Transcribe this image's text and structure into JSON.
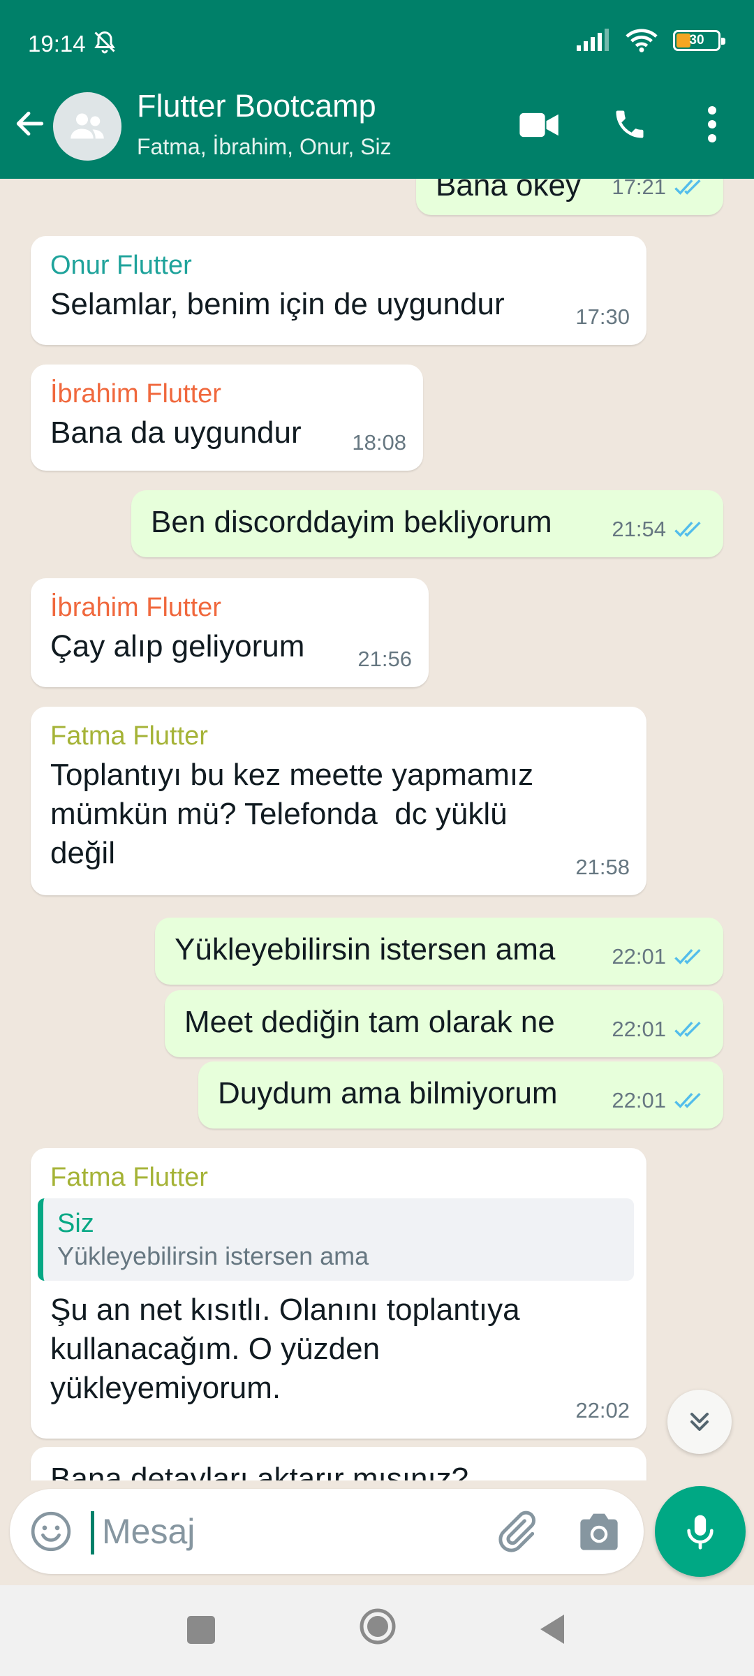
{
  "status_bar": {
    "time": "19:14",
    "battery": "30"
  },
  "header": {
    "title": "Flutter Bootcamp",
    "subtitle": "Fatma, İbrahim, Onur, Siz"
  },
  "colors": {
    "header": "#008069",
    "accent": "#00a884",
    "outgoing_bubble": "#e7ffdb",
    "incoming_bubble": "#ffffff",
    "sender_onur": "#1fa39b",
    "sender_ibrahim": "#f0683d",
    "sender_fatma": "#a5b337",
    "read_ticks": "#53bdeb"
  },
  "messages": [
    {
      "dir": "out",
      "text": "Bana okey",
      "time": "17:21",
      "read": true
    },
    {
      "dir": "in",
      "sender": "Onur Flutter",
      "text": "Selamlar, benim için de uygundur",
      "time": "17:30"
    },
    {
      "dir": "in",
      "sender": "İbrahim Flutter",
      "text": "Bana da uygundur",
      "time": "18:08"
    },
    {
      "dir": "out",
      "text": "Ben discorddayim bekliyorum",
      "time": "21:54",
      "read": true
    },
    {
      "dir": "in",
      "sender": "İbrahim Flutter",
      "text": "Çay alıp geliyorum",
      "time": "21:56"
    },
    {
      "dir": "in",
      "sender": "Fatma Flutter",
      "text": "Toplantıyı bu kez meette yapmamız\nmümkün mü? Telefonda  dc yüklü\ndeğil",
      "time": "21:58"
    },
    {
      "dir": "out",
      "text": "Yükleyebilirsin istersen ama",
      "time": "22:01",
      "read": true
    },
    {
      "dir": "out",
      "text": "Meet dediğin tam olarak ne",
      "time": "22:01",
      "read": true
    },
    {
      "dir": "out",
      "text": "Duydum ama bilmiyorum",
      "time": "22:01",
      "read": true
    },
    {
      "dir": "in",
      "sender": "Fatma Flutter",
      "quote": {
        "name": "Siz",
        "text": "Yükleyebilirsin istersen ama"
      },
      "text": "Şu an net kısıtlı. Olanını toplantıya\nkullanacağım. O yüzden\nyükleyemiyorum.",
      "time": "22:02"
    },
    {
      "dir": "in",
      "text": "Bana detayları aktarır mısınız?"
    }
  ],
  "composer": {
    "placeholder": "Mesaj"
  },
  "icons": [
    "bell-off-icon",
    "signal-icon",
    "wifi-icon",
    "battery-icon",
    "back-arrow-icon",
    "group-avatar-icon",
    "video-call-icon",
    "phone-icon",
    "more-vert-icon",
    "double-check-icon",
    "chevron-double-down-icon",
    "emoji-icon",
    "attach-icon",
    "camera-icon",
    "mic-icon"
  ]
}
